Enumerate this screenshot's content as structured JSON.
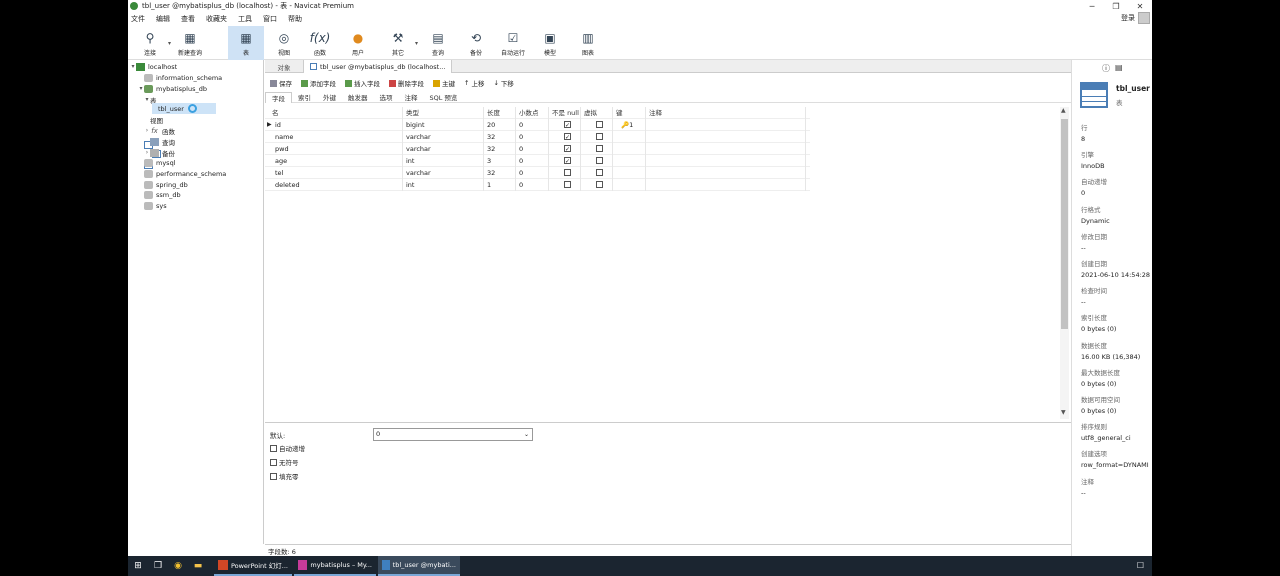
{
  "window": {
    "title": "tbl_user @mybatisplus_db (localhost) - 表 - Navicat Premium",
    "login": "登录"
  },
  "menu": [
    "文件",
    "编辑",
    "查看",
    "收藏夹",
    "工具",
    "窗口",
    "帮助"
  ],
  "toolbar": [
    {
      "label": "连接",
      "icon": "plug-icon"
    },
    {
      "label": "新建查询",
      "icon": "new-query-icon"
    },
    {
      "label": "表",
      "icon": "table-icon"
    },
    {
      "label": "视图",
      "icon": "view-icon"
    },
    {
      "label": "函数",
      "icon": "function-icon"
    },
    {
      "label": "用户",
      "icon": "user-icon"
    },
    {
      "label": "其它",
      "icon": "tools-icon"
    },
    {
      "label": "查询",
      "icon": "query-icon"
    },
    {
      "label": "备份",
      "icon": "backup-icon"
    },
    {
      "label": "自动运行",
      "icon": "schedule-icon"
    },
    {
      "label": "模型",
      "icon": "model-icon"
    },
    {
      "label": "图表",
      "icon": "chart-icon"
    }
  ],
  "tree": [
    {
      "label": "localhost"
    },
    {
      "label": "information_schema"
    },
    {
      "label": "mybatisplus_db"
    },
    {
      "label": "表"
    },
    {
      "label": "tbl_user"
    },
    {
      "label": "视图"
    },
    {
      "label": "函数"
    },
    {
      "label": "查询"
    },
    {
      "label": "备份"
    },
    {
      "label": "mysql"
    },
    {
      "label": "performance_schema"
    },
    {
      "label": "spring_db"
    },
    {
      "label": "ssm_db"
    },
    {
      "label": "sys"
    }
  ],
  "tabs": {
    "objects": "对象",
    "editor": "tbl_user @mybatisplus_db (localhost..."
  },
  "subtoolbar": [
    "保存",
    "添加字段",
    "插入字段",
    "删除字段",
    "主键",
    "上移",
    "下移"
  ],
  "subtabs": [
    "字段",
    "索引",
    "外键",
    "触发器",
    "选项",
    "注释",
    "SQL 预览"
  ],
  "grid": {
    "headers": [
      "名",
      "类型",
      "长度",
      "小数点",
      "不是 null",
      "虚拟",
      "键",
      "注释"
    ],
    "rows": [
      {
        "name": "id",
        "type": "bigint",
        "len": "20",
        "dec": "0",
        "notnull": true,
        "key": "1"
      },
      {
        "name": "name",
        "type": "varchar",
        "len": "32",
        "dec": "0",
        "notnull": true,
        "key": ""
      },
      {
        "name": "pwd",
        "type": "varchar",
        "len": "32",
        "dec": "0",
        "notnull": true,
        "key": ""
      },
      {
        "name": "age",
        "type": "int",
        "len": "3",
        "dec": "0",
        "notnull": true,
        "key": ""
      },
      {
        "name": "tel",
        "type": "varchar",
        "len": "32",
        "dec": "0",
        "notnull": false,
        "key": ""
      },
      {
        "name": "deleted",
        "type": "int",
        "len": "1",
        "dec": "0",
        "notnull": false,
        "key": ""
      }
    ]
  },
  "lower": {
    "default_label": "默认:",
    "default_value": "0",
    "options": [
      "自动递增",
      "无符号",
      "填充零"
    ]
  },
  "status": "字段数: 6",
  "info": {
    "name": "tbl_user",
    "kind": "表",
    "props": [
      {
        "k": "行",
        "v": "8"
      },
      {
        "k": "引擎",
        "v": "InnoDB"
      },
      {
        "k": "自动递增",
        "v": "0"
      },
      {
        "k": "行格式",
        "v": "Dynamic"
      },
      {
        "k": "修改日期",
        "v": "--"
      },
      {
        "k": "创建日期",
        "v": "2021-06-10 14:54:28"
      },
      {
        "k": "检查时间",
        "v": "--"
      },
      {
        "k": "索引长度",
        "v": "0 bytes (0)"
      },
      {
        "k": "数据长度",
        "v": "16.00 KB (16,384)"
      },
      {
        "k": "最大数据长度",
        "v": "0 bytes (0)"
      },
      {
        "k": "数据可用空间",
        "v": "0 bytes (0)"
      },
      {
        "k": "排序规则",
        "v": "utf8_general_ci"
      },
      {
        "k": "创建选项",
        "v": "row_format=DYNAMI"
      },
      {
        "k": "注释",
        "v": "--"
      }
    ]
  },
  "taskbar": [
    {
      "label": "PowerPoint 幻灯...",
      "color": "#d24726"
    },
    {
      "label": "mybatisplus – My...",
      "color": "#c73b9a"
    },
    {
      "label": "tbl_user @mybati...",
      "color": "#3f7fbf"
    }
  ]
}
